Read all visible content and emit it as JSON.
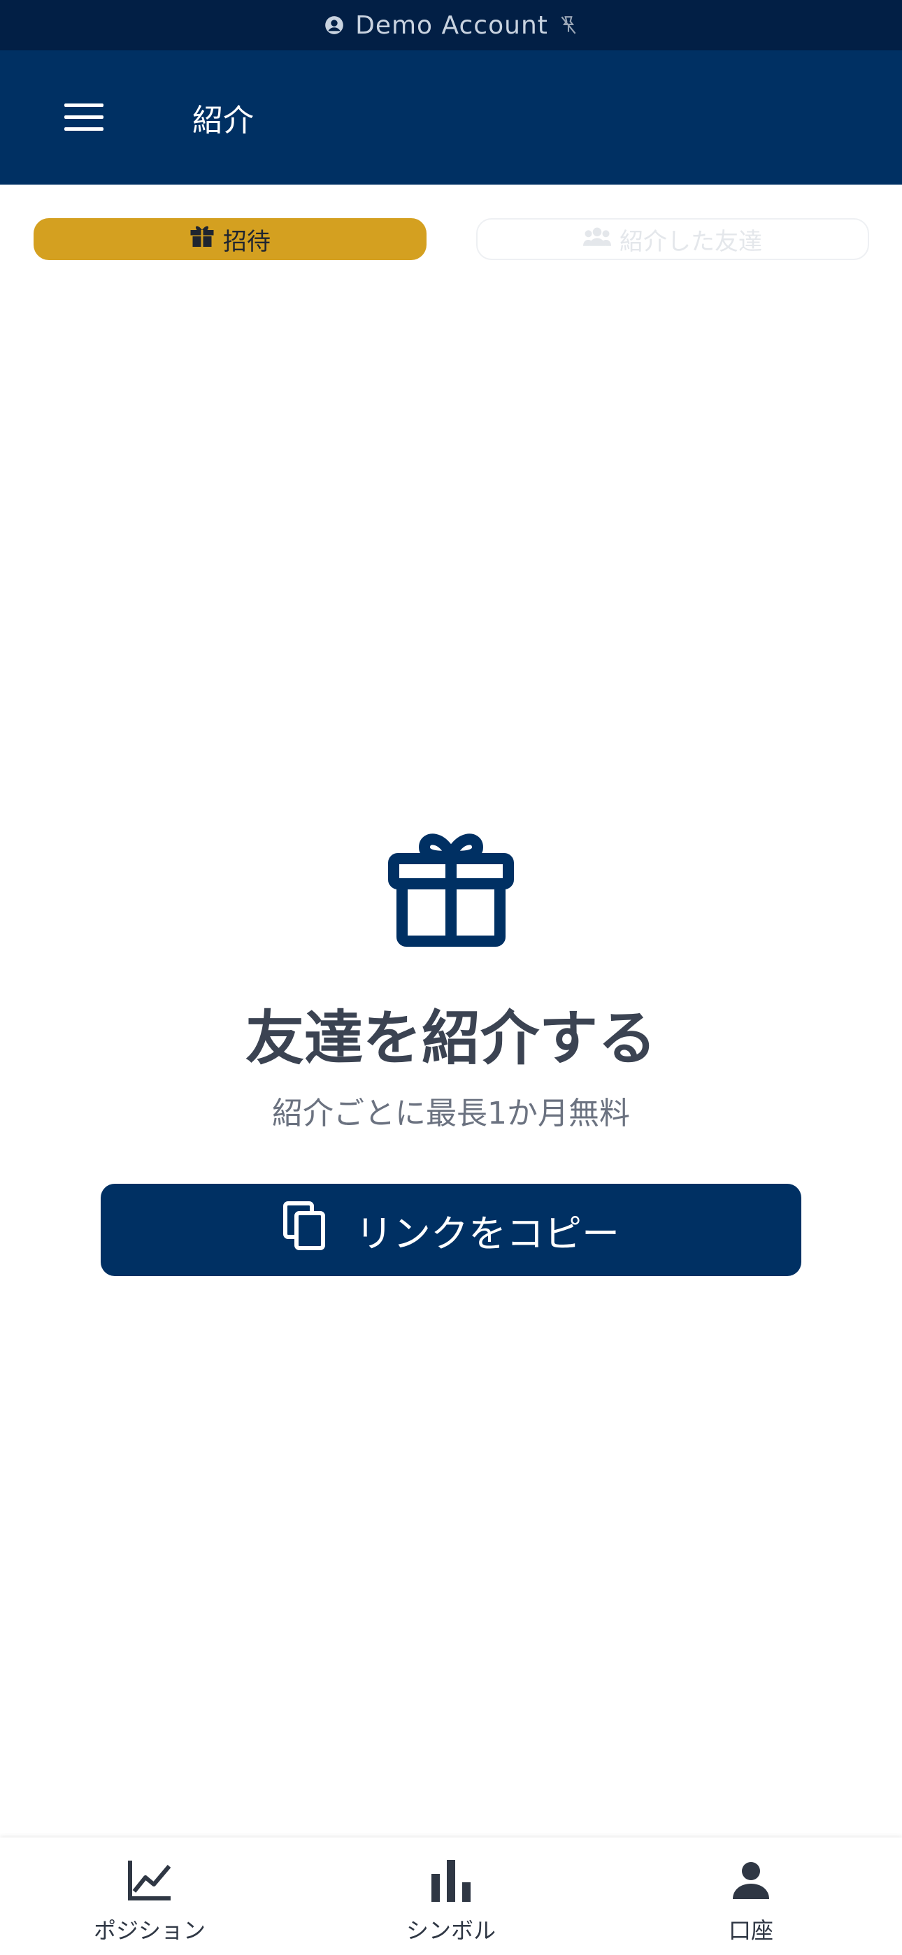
{
  "status_bar": {
    "account_label": "Demo Account",
    "account_icon": "user-circle-icon",
    "connection_icon": "pin-off-icon"
  },
  "app_bar": {
    "title": "紹介",
    "menu_icon": "hamburger-menu-icon"
  },
  "tabs": [
    {
      "label": "招待",
      "icon": "gift-icon",
      "active": true
    },
    {
      "label": "紹介した友達",
      "icon": "users-icon",
      "active": false
    }
  ],
  "hero": {
    "icon": "gift-icon",
    "title": "友達を紹介する",
    "subtitle": "紹介ごとに最長1か月無料",
    "button_label": "リンクをコピー",
    "button_icon": "copy-icon"
  },
  "bottom_nav": [
    {
      "label": "ポジション",
      "icon": "line-chart-icon"
    },
    {
      "label": "シンボル",
      "icon": "bar-chart-icon"
    },
    {
      "label": "口座",
      "icon": "person-icon"
    }
  ],
  "colors": {
    "status_bar_bg": "#021f45",
    "app_bar_bg": "#003063",
    "accent_gold": "#d4a020",
    "primary_navy": "#003063",
    "title_text": "#3b4352",
    "subtitle_text": "#6b7280"
  }
}
